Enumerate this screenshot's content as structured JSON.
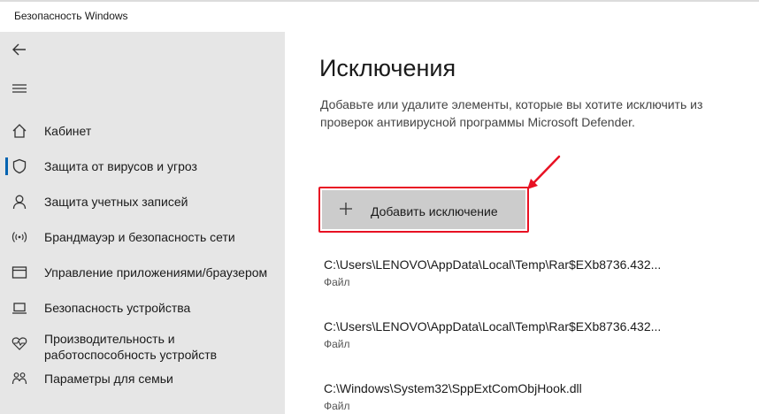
{
  "window": {
    "title": "Безопасность Windows"
  },
  "sidebar": {
    "items": [
      {
        "label": "Кабинет",
        "icon": "home-icon"
      },
      {
        "label": "Защита от вирусов и угроз",
        "icon": "shield-icon",
        "active": true
      },
      {
        "label": "Защита учетных записей",
        "icon": "person-icon"
      },
      {
        "label": "Брандмауэр и безопасность сети",
        "icon": "wifi-antenna-icon"
      },
      {
        "label": "Управление приложениями/браузером",
        "icon": "browser-window-icon"
      },
      {
        "label": "Безопасность устройства",
        "icon": "laptop-icon"
      },
      {
        "label": "Производительность и работоспособность устройств",
        "icon": "heart-pulse-icon"
      },
      {
        "label": "Параметры для семьи",
        "icon": "family-icon"
      }
    ]
  },
  "main": {
    "title": "Исключения",
    "description": "Добавьте или удалите элементы, которые вы хотите исключить из проверок антивирусной программы Microsoft Defender.",
    "add_button": {
      "label": "Добавить исключение",
      "icon": "plus-icon"
    },
    "exclusions": [
      {
        "path": "C:\\Users\\LENOVO\\AppData\\Local\\Temp\\Rar$EXb8736.432...",
        "type": "Файл"
      },
      {
        "path": "C:\\Users\\LENOVO\\AppData\\Local\\Temp\\Rar$EXb8736.432...",
        "type": "Файл"
      },
      {
        "path": "C:\\Windows\\System32\\SppExtComObjHook.dll",
        "type": "Файл"
      }
    ]
  },
  "colors": {
    "accent": "#0063b1",
    "highlight": "#e81123",
    "sidebar_bg": "#e6e6e6",
    "button_bg": "#cccccc"
  }
}
